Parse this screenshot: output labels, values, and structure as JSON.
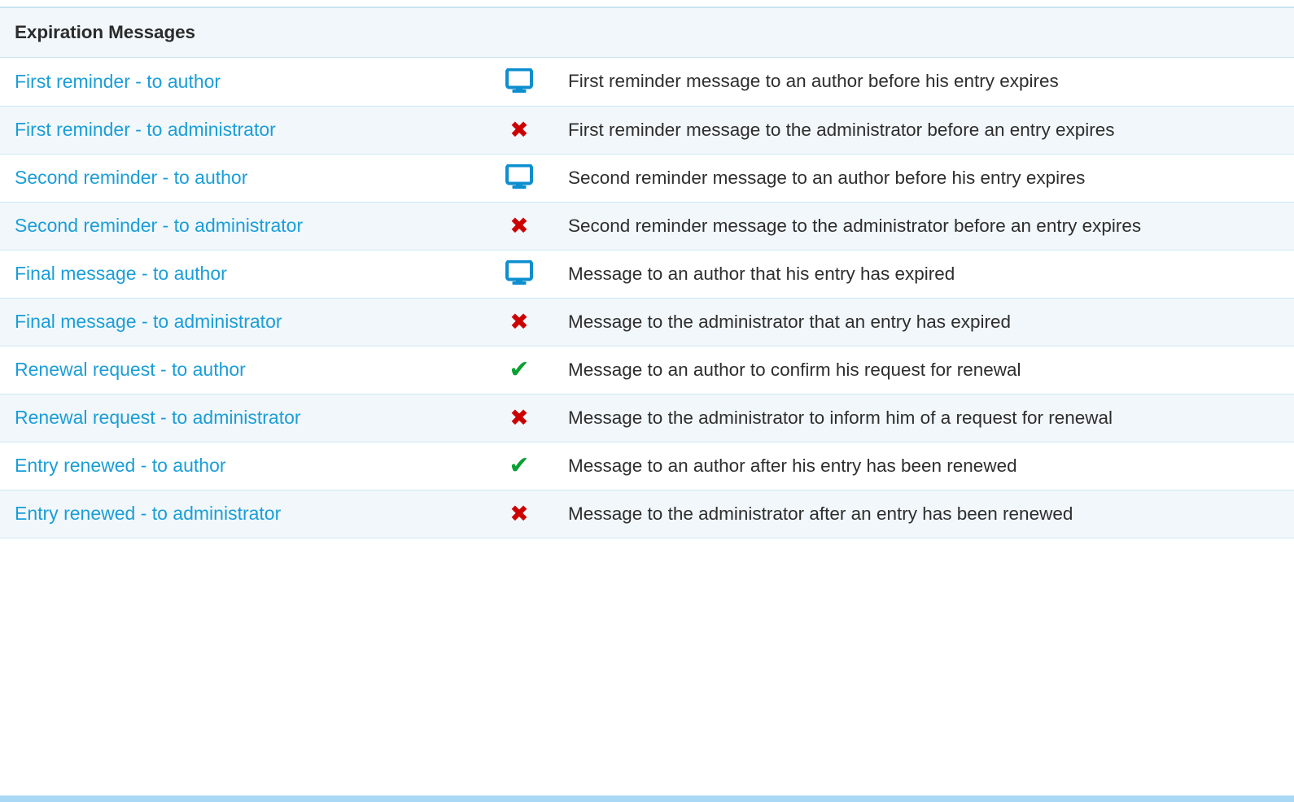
{
  "panel": {
    "title": "Expiration Messages"
  },
  "colors": {
    "link": "#1b9ed8",
    "icon_monitor": "#0d8ecf",
    "icon_cross": "#cc0000",
    "icon_check": "#0aa032",
    "row_stripe": "#f1f7fa",
    "row_border": "#cfe7f5",
    "header_bg": "#f1f7fa",
    "bottom_bar": "#a8d8f5",
    "text": "#2e2e2e"
  },
  "rows": [
    {
      "name": "First reminder - to author",
      "icon": "monitor-icon",
      "description": "First reminder message to an author before his entry expires"
    },
    {
      "name": "First reminder - to administrator",
      "icon": "cross-icon",
      "description": "First reminder message to the administrator before an entry expires"
    },
    {
      "name": "Second reminder - to author",
      "icon": "monitor-icon",
      "description": "Second reminder message to an author before his entry expires"
    },
    {
      "name": "Second reminder - to administrator",
      "icon": "cross-icon",
      "description": "Second reminder message to the administrator before an entry expires"
    },
    {
      "name": "Final message - to author",
      "icon": "monitor-icon",
      "description": "Message to an author that his entry has expired"
    },
    {
      "name": "Final message - to administrator",
      "icon": "cross-icon",
      "description": "Message to the administrator that an entry has expired"
    },
    {
      "name": "Renewal request - to author",
      "icon": "check-icon",
      "description": "Message to an author to confirm his request for renewal"
    },
    {
      "name": "Renewal request - to administrator",
      "icon": "cross-icon",
      "description": "Message to the administrator to inform him of a request for renewal"
    },
    {
      "name": "Entry renewed - to author",
      "icon": "check-icon",
      "description": "Message to an author after his entry has been renewed"
    },
    {
      "name": "Entry renewed - to administrator",
      "icon": "cross-icon",
      "description": "Message to the administrator after an entry has been renewed"
    }
  ]
}
